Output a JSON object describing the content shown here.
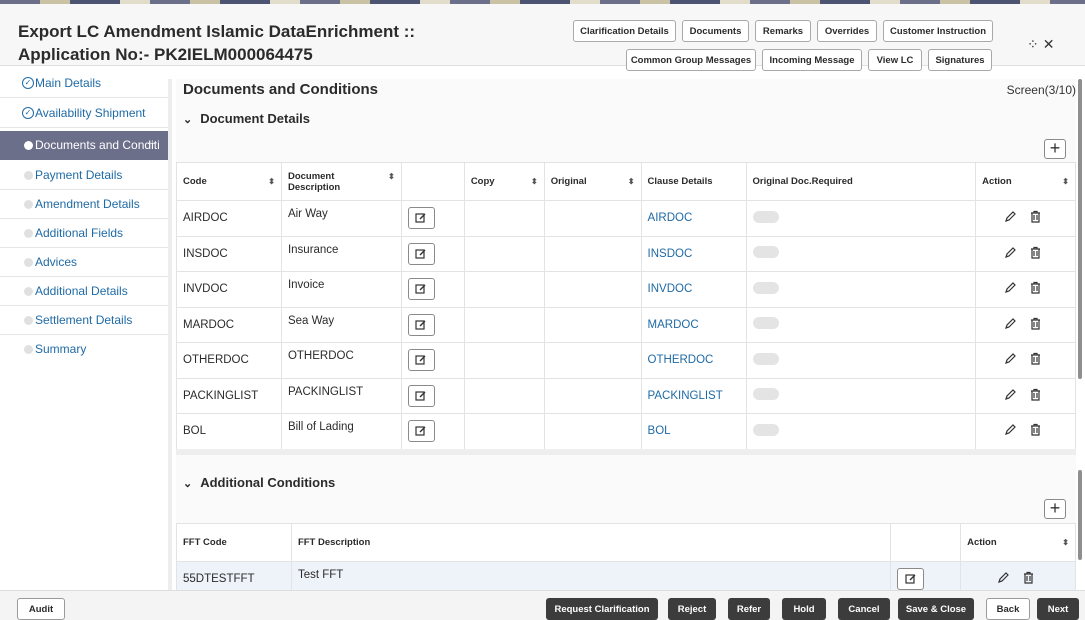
{
  "header": {
    "title_line1": "Export LC Amendment Islamic DataEnrichment ::",
    "title_line2": "Application No:- PK2IELM000064475",
    "buttons_row1": [
      "Clarification Details",
      "Documents",
      "Remarks",
      "Overrides",
      "Customer Instruction"
    ],
    "buttons_row2": [
      "Common Group Messages",
      "Incoming Message",
      "View LC",
      "Signatures"
    ]
  },
  "sidebar": {
    "items": [
      {
        "label": "Main Details",
        "state": "done"
      },
      {
        "label": "Availability Shipment",
        "state": "done"
      },
      {
        "label": "Documents and Conditi",
        "state": "active"
      },
      {
        "label": "Payment Details",
        "state": "todo"
      },
      {
        "label": "Amendment Details",
        "state": "todo"
      },
      {
        "label": "Additional Fields",
        "state": "todo"
      },
      {
        "label": "Advices",
        "state": "todo"
      },
      {
        "label": "Additional Details",
        "state": "todo"
      },
      {
        "label": "Settlement Details",
        "state": "todo"
      },
      {
        "label": "Summary",
        "state": "todo"
      }
    ],
    "active_ellipsis": "..."
  },
  "main": {
    "page_title": "Documents and Conditions",
    "screen_no": "Screen(3/10)",
    "documents": {
      "section_title": "Document Details",
      "columns": [
        "Code",
        "Document Description",
        "",
        "Copy",
        "Original",
        "Clause Details",
        "Original Doc.Required",
        "Action"
      ],
      "rows": [
        {
          "code": "AIRDOC",
          "description": "Air Way",
          "clause": "AIRDOC"
        },
        {
          "code": "INSDOC",
          "description": "Insurance",
          "clause": "INSDOC"
        },
        {
          "code": "INVDOC",
          "description": "Invoice",
          "clause": "INVDOC"
        },
        {
          "code": "MARDOC",
          "description": "Sea Way",
          "clause": "MARDOC"
        },
        {
          "code": "OTHERDOC",
          "description": "OTHERDOC",
          "clause": "OTHERDOC"
        },
        {
          "code": "PACKINGLIST",
          "description": "PACKINGLIST",
          "clause": "PACKINGLIST"
        },
        {
          "code": "BOL",
          "description": "Bill of Lading",
          "clause": "BOL"
        }
      ]
    },
    "conditions": {
      "section_title": "Additional Conditions",
      "columns": [
        "FFT Code",
        "FFT Description",
        "",
        "Action"
      ],
      "rows": [
        {
          "code": "55DTESTFFT",
          "description": "Test FFT"
        }
      ]
    }
  },
  "footer": {
    "audit": "Audit",
    "buttons": [
      "Request Clarification",
      "Reject",
      "Refer",
      "Hold",
      "Cancel",
      "Save & Close",
      "Back",
      "Next"
    ]
  },
  "icons": {
    "edit_box": "edit-icon",
    "pencil": "pencil-icon",
    "trash": "trash-icon",
    "plus": "plus-icon",
    "sort": "sort-icon"
  },
  "colors": {
    "accent": "#6b6f8a",
    "link": "#1f6aa5",
    "dark_button": "#3c3c3c"
  }
}
